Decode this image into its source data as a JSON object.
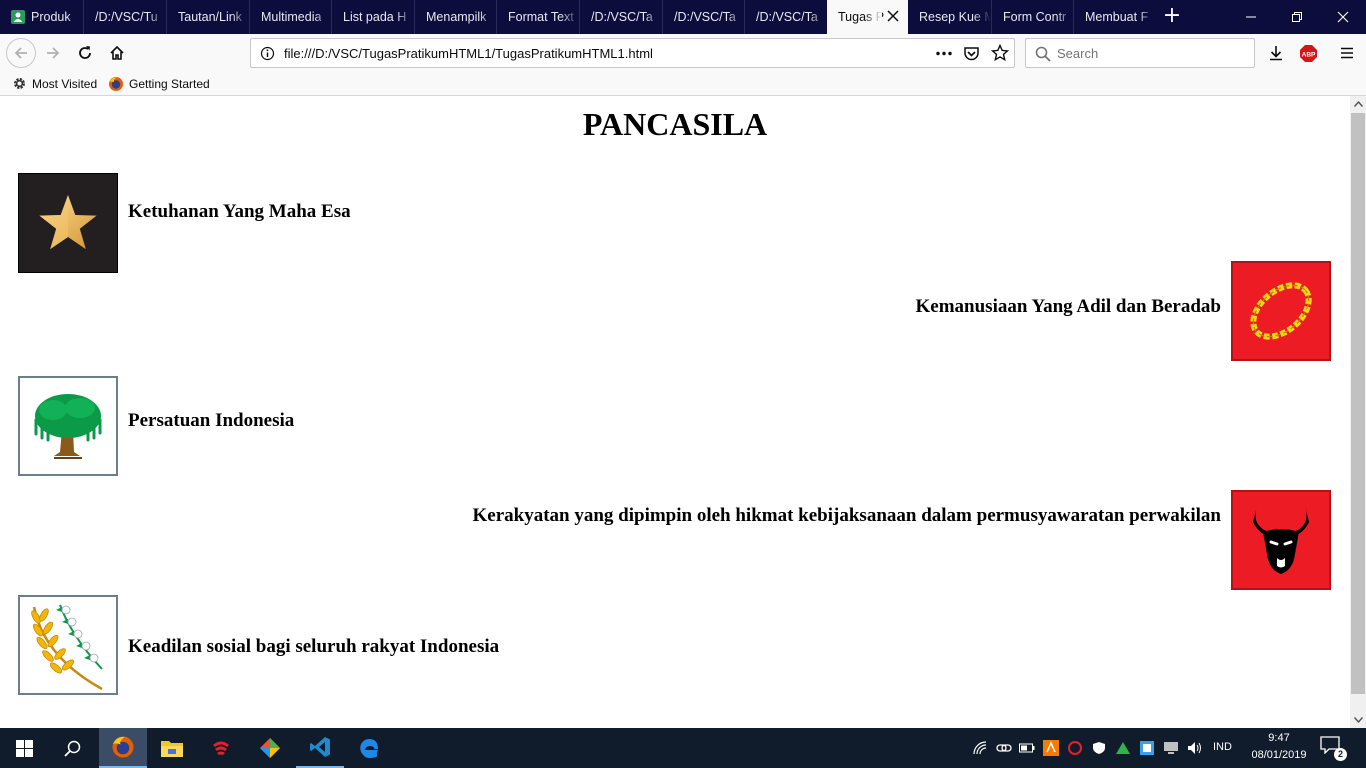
{
  "browser": {
    "tabs": [
      {
        "label": "Produk"
      },
      {
        "label": "/D:/VSC/Tu"
      },
      {
        "label": "Tautan/Link"
      },
      {
        "label": "Multimedia"
      },
      {
        "label": "List pada H"
      },
      {
        "label": "Menampilk"
      },
      {
        "label": "Format Text"
      },
      {
        "label": "/D:/VSC/Ta"
      },
      {
        "label": "/D:/VSC/Ta"
      },
      {
        "label": "/D:/VSC/Ta"
      },
      {
        "label": "Tugas P"
      },
      {
        "label": "Resep Kue M"
      },
      {
        "label": "Form Contr"
      },
      {
        "label": "Membuat F"
      }
    ],
    "new_tab_label": "+",
    "url": "file:///D:/VSC/TugasPratikumHTML1/TugasPratikumHTML1.html",
    "search_placeholder": "Search",
    "bookmarks": [
      {
        "label": "Most Visited",
        "icon": "gear-icon"
      },
      {
        "label": "Getting Started",
        "icon": "firefox-icon"
      }
    ],
    "abp_label": "ABP"
  },
  "page": {
    "title": "PANCASILA",
    "sila": [
      {
        "text": "Ketuhanan Yang Maha Esa",
        "icon": "star-icon",
        "bg": "#231f20"
      },
      {
        "text": "Kemanusiaan Yang Adil dan Beradab",
        "icon": "chain-icon",
        "bg": "#ed1c24"
      },
      {
        "text": "Persatuan Indonesia",
        "icon": "banyan-tree-icon",
        "bg": "#ffffff"
      },
      {
        "text": "Kerakyatan yang dipimpin oleh hikmat kebijaksanaan dalam permusyawaratan perwakilan",
        "icon": "bull-head-icon",
        "bg": "#ed1c24"
      },
      {
        "text": "Keadilan sosial bagi seluruh rakyat Indonesia",
        "icon": "rice-cotton-icon",
        "bg": "#ffffff"
      }
    ]
  },
  "taskbar": {
    "language": "IND",
    "time": "9:47",
    "date": "08/01/2019",
    "notification_count": "2"
  },
  "colors": {
    "tabbar": "#0c0c3d",
    "taskbar": "#101c2c",
    "accent": "#76b9ed"
  }
}
